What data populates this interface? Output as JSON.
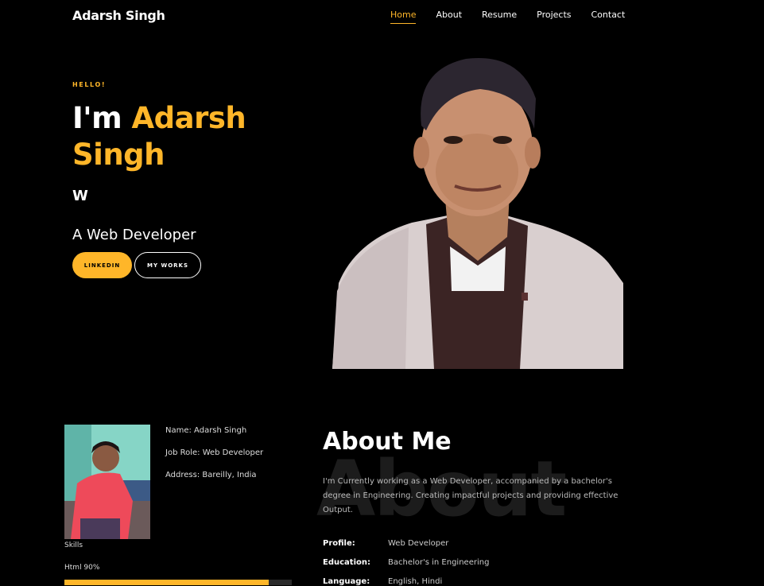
{
  "brand": "Adarsh Singh",
  "nav": [
    {
      "label": "Home",
      "active": true
    },
    {
      "label": "About",
      "active": false
    },
    {
      "label": "Resume",
      "active": false
    },
    {
      "label": "Projects",
      "active": false
    },
    {
      "label": "Contact",
      "active": false
    }
  ],
  "hero": {
    "eyebrow": "HELLO!",
    "greeting": "I'm ",
    "name": "Adarsh Singh",
    "typed": "W",
    "subtitle": "A Web Developer",
    "buttons": {
      "linkedin": "LINKEDIN",
      "works": "MY WORKS"
    }
  },
  "info": {
    "name": "Name: Adarsh Singh",
    "role": "Job Role: Web Developer",
    "address": "Address: Bareilly, India"
  },
  "skills": {
    "label": "Skills",
    "items": [
      {
        "label": "Html 90%",
        "percent": 90
      }
    ]
  },
  "about": {
    "watermark": "About",
    "title": "About Me",
    "text": "I'm Currently working as a Web Developer, accompanied by a bachelor's degree in Engineering. Creating impactful projects and providing effective Output.",
    "details": [
      {
        "key": "Profile:",
        "value": "Web Developer"
      },
      {
        "key": "Education:",
        "value": "Bachelor's in Engineering"
      },
      {
        "key": "Language:",
        "value": "English, Hindi"
      }
    ]
  },
  "colors": {
    "accent": "#ffb629",
    "background": "#000000"
  },
  "icons": {
    "hero_photo": "portrait-photo",
    "profile_photo": "profile-photo"
  }
}
